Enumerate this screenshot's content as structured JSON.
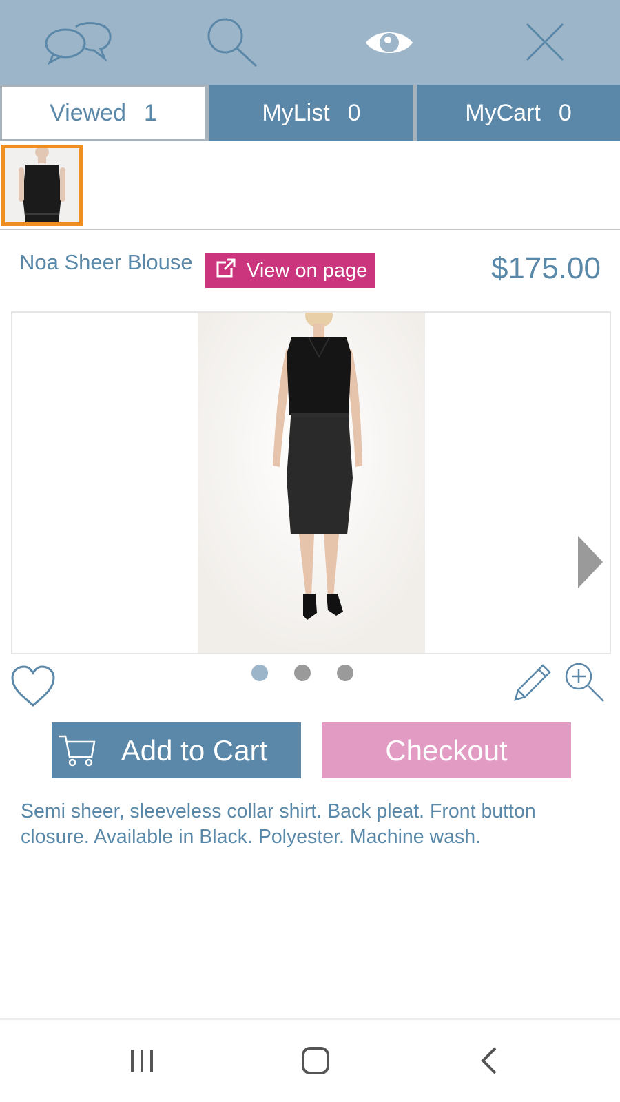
{
  "topbar": {
    "icons": [
      "chat-bubbles-icon",
      "search-icon",
      "eye-icon",
      "close-icon"
    ],
    "background": "#9db5c9"
  },
  "tabs": [
    {
      "label": "Viewed",
      "count": "1",
      "active": true
    },
    {
      "label": "MyList",
      "count": "0",
      "active": false
    },
    {
      "label": "MyCart",
      "count": "0",
      "active": false
    }
  ],
  "product": {
    "name": "Noa Sheer Blouse",
    "view_label": "View on page",
    "price": "$175.00",
    "image_count": 3,
    "active_image": 1,
    "description": "Semi sheer, sleeveless collar shirt. Back pleat. Front button closure. Available in Black. Polyester. Machine wash."
  },
  "buttons": {
    "add_to_cart": "Add to Cart",
    "checkout": "Checkout"
  },
  "colors": {
    "accent_blue": "#5b88a8",
    "pink_cta": "#cb357d",
    "checkout_pink": "#e29bc2",
    "thumb_border": "#ef8f22"
  },
  "system_nav": [
    "recent-apps-icon",
    "home-icon",
    "back-icon"
  ]
}
